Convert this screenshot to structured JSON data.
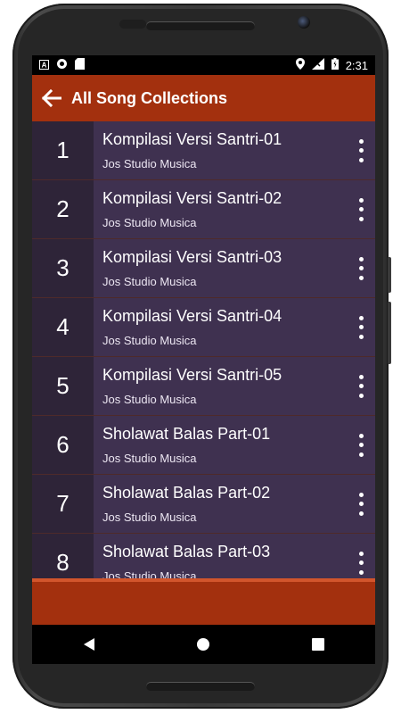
{
  "status_bar": {
    "left_icons": [
      "a-icon",
      "circle-icon",
      "sd-card-icon"
    ],
    "right_icons": [
      "location-icon",
      "signal-icon",
      "battery-icon"
    ],
    "time": "2:31"
  },
  "app_bar": {
    "title": "All Song Collections",
    "back_icon": "arrow-back-icon"
  },
  "songs": [
    {
      "number": "1",
      "title": "Kompilasi Versi Santri-01",
      "artist": "Jos Studio Musica"
    },
    {
      "number": "2",
      "title": "Kompilasi Versi Santri-02",
      "artist": "Jos Studio Musica"
    },
    {
      "number": "3",
      "title": "Kompilasi Versi Santri-03",
      "artist": "Jos Studio Musica"
    },
    {
      "number": "4",
      "title": "Kompilasi Versi Santri-04",
      "artist": "Jos Studio Musica"
    },
    {
      "number": "5",
      "title": "Kompilasi Versi Santri-05",
      "artist": "Jos Studio Musica"
    },
    {
      "number": "6",
      "title": "Sholawat Balas Part-01",
      "artist": "Jos Studio Musica"
    },
    {
      "number": "7",
      "title": "Sholawat Balas Part-02",
      "artist": "Jos Studio Musica"
    },
    {
      "number": "8",
      "title": "Sholawat Balas Part-03",
      "artist": "Jos Studio Musica"
    }
  ],
  "colors": {
    "accent": "#a3300e",
    "row_number_bg": "#2e2438",
    "row_bg": "#3f3150"
  },
  "nav_bar": {
    "icons": [
      "back-triangle-icon",
      "home-circle-icon",
      "recents-square-icon"
    ]
  }
}
